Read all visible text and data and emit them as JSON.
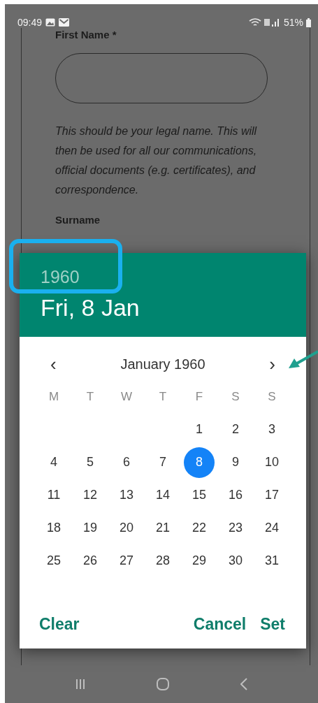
{
  "status_bar": {
    "time": "09:49",
    "battery": "51%"
  },
  "form": {
    "first_name_label": "First Name *",
    "hint": "This should be your legal name. This will then be used for all our communications, official documents (e.g. certificates), and correspondence.",
    "surname_label": "Surname"
  },
  "dialog": {
    "year": "1960",
    "date": "Fri, 8 Jan",
    "month": "January 1960",
    "prev": "‹",
    "next": "›",
    "weekdays": [
      "M",
      "T",
      "W",
      "T",
      "F",
      "S",
      "S"
    ],
    "weeks": [
      [
        {
          "label": "1",
          "selected": false
        },
        {
          "label": "2",
          "selected": false
        },
        {
          "label": "3",
          "selected": false
        }
      ],
      [
        {
          "label": "4",
          "selected": false
        },
        {
          "label": "5",
          "selected": false
        },
        {
          "label": "6",
          "selected": false
        },
        {
          "label": "7",
          "selected": false
        },
        {
          "label": "8",
          "selected": true
        },
        {
          "label": "9",
          "selected": false
        },
        {
          "label": "10",
          "selected": false
        }
      ],
      [
        {
          "label": "11",
          "selected": false
        },
        {
          "label": "12",
          "selected": false
        },
        {
          "label": "13",
          "selected": false
        },
        {
          "label": "14",
          "selected": false
        },
        {
          "label": "15",
          "selected": false
        },
        {
          "label": "16",
          "selected": false
        },
        {
          "label": "17",
          "selected": false
        }
      ],
      [
        {
          "label": "18",
          "selected": false
        },
        {
          "label": "19",
          "selected": false
        },
        {
          "label": "20",
          "selected": false
        },
        {
          "label": "21",
          "selected": false
        },
        {
          "label": "22",
          "selected": false
        },
        {
          "label": "23",
          "selected": false
        },
        {
          "label": "24",
          "selected": false
        }
      ],
      [
        {
          "label": "25",
          "selected": false
        },
        {
          "label": "26",
          "selected": false
        },
        {
          "label": "27",
          "selected": false
        },
        {
          "label": "28",
          "selected": false
        },
        {
          "label": "29",
          "selected": false
        },
        {
          "label": "30",
          "selected": false
        },
        {
          "label": "31",
          "selected": false
        }
      ]
    ],
    "buttons": [
      {
        "label": "Clear",
        "kind": "left"
      },
      {
        "label": "Cancel",
        "kind": "right"
      },
      {
        "label": "Set",
        "kind": "right"
      }
    ]
  }
}
